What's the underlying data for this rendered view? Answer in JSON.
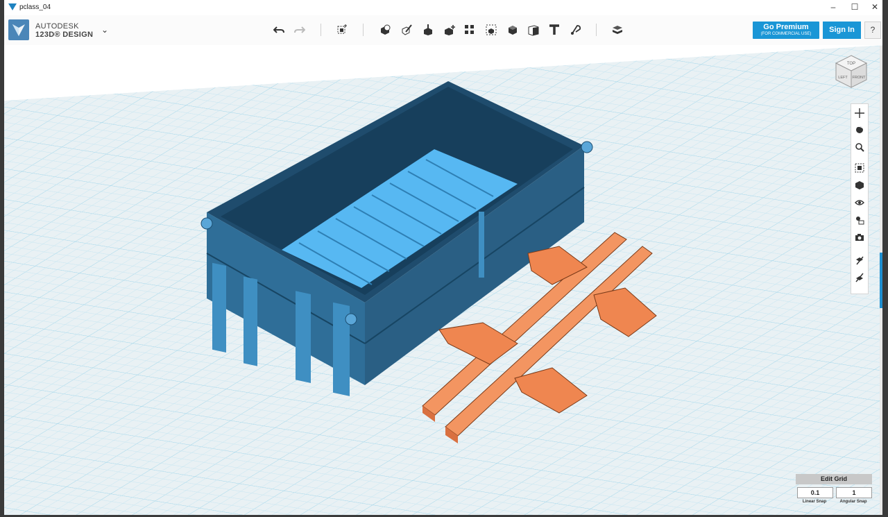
{
  "window": {
    "title": "pclass_04",
    "controls": [
      "minimize-icon",
      "maximize-icon",
      "close-icon"
    ]
  },
  "app": {
    "brand_top": "AUTODESK",
    "brand_bottom": "123D® DESIGN",
    "menu_icon": "chevron-down-icon"
  },
  "toolbar": {
    "tools": [
      "undo-icon",
      "redo-icon",
      "transform-icon",
      "primitives-icon",
      "sketch-icon",
      "construct-icon",
      "modify-icon",
      "pattern-icon",
      "grouping-icon",
      "combine-icon",
      "measure-icon",
      "text-icon",
      "snap-icon",
      "material-icon"
    ],
    "premium_label": "Go Premium",
    "premium_sublabel": "(FOR COMMERCIAL USE)",
    "signin_label": "Sign In",
    "help_label": "?"
  },
  "viewcube": {
    "top": "TOP",
    "left": "LEFT",
    "front": "FRONT"
  },
  "nav_tools": [
    "pan-icon",
    "orbit-icon",
    "zoom-icon",
    "fit-icon",
    "perspective-icon",
    "visibility-icon",
    "material-view-icon",
    "camera-icon",
    "snap-tool-icon",
    "grid-tool-icon"
  ],
  "grid": {
    "edit_label": "Edit Grid",
    "linear_snap_value": "0.1",
    "angular_snap_value": "1",
    "linear_snap_label": "Linear Snap",
    "angular_snap_label": "Angular Snap"
  },
  "colors": {
    "accent": "#1a96d6",
    "box_body": "#3c97cf",
    "box_floor": "#5ab9f0",
    "chassis": "#f08a55",
    "grid_bg": "#e8f0f3",
    "grid_line": "#aedceb"
  }
}
